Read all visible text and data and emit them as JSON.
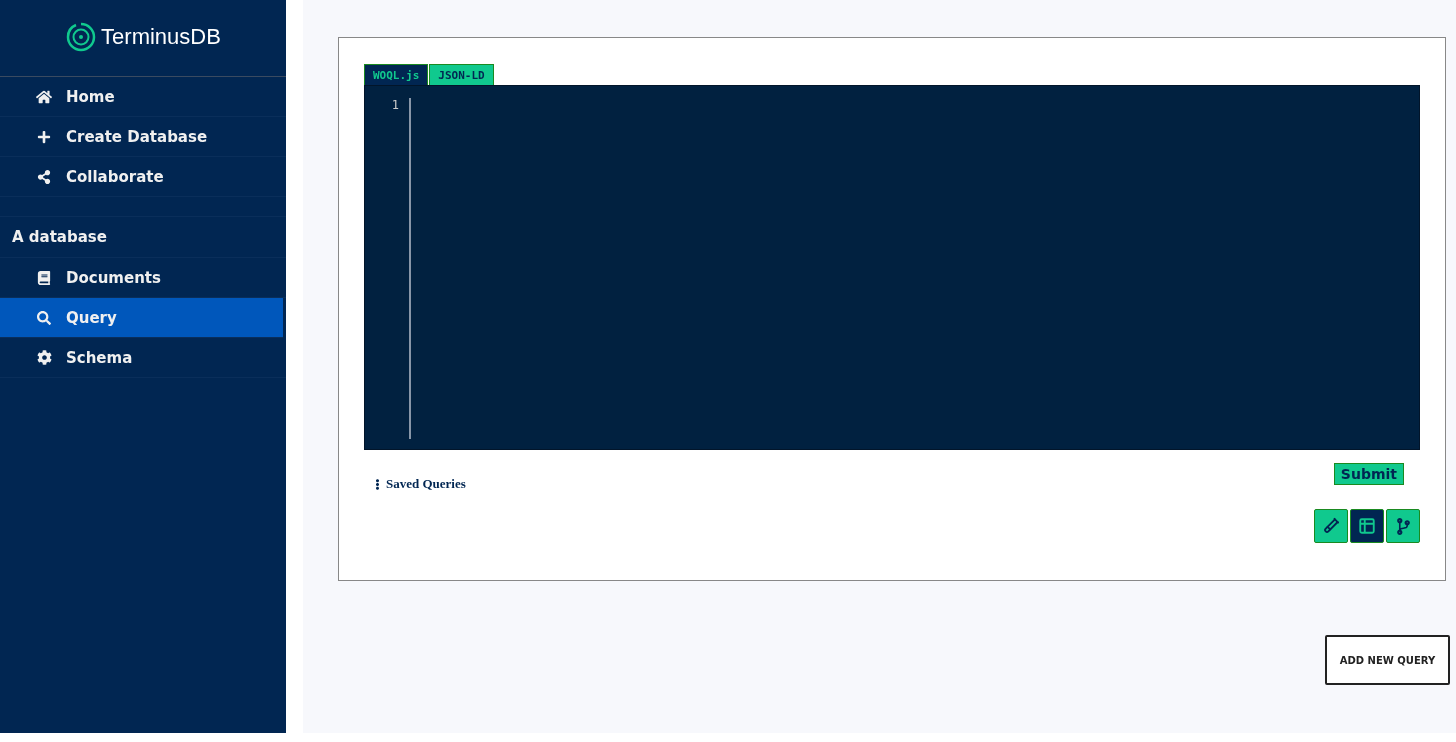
{
  "sidebar": {
    "logo": "TerminusDB",
    "items": [
      {
        "label": "Home",
        "kind": "home",
        "selected": false
      },
      {
        "label": "Create Database",
        "kind": "plus",
        "selected": false
      },
      {
        "label": "Collaborate",
        "kind": "share",
        "selected": false
      }
    ],
    "section": {
      "title": "A database",
      "items": [
        {
          "label": "Documents",
          "kind": "book",
          "selected": false
        },
        {
          "label": "Query",
          "kind": "search",
          "selected": true
        },
        {
          "label": "Schema",
          "kind": "gear",
          "selected": false
        }
      ]
    }
  },
  "query_panel": {
    "tabs": [
      {
        "label": "WOQL.js",
        "selected": true
      },
      {
        "label": "JSON-LD",
        "selected": false
      }
    ],
    "editor": {
      "line_numbers": [
        "1"
      ]
    },
    "saved_queries": "Saved Queries",
    "submit": "Submit",
    "view_buttons": [
      {
        "kind": "flask",
        "selected": false
      },
      {
        "kind": "table",
        "selected": true
      },
      {
        "kind": "graph",
        "selected": false
      }
    ]
  },
  "add_query": "ADD NEW QUERY"
}
